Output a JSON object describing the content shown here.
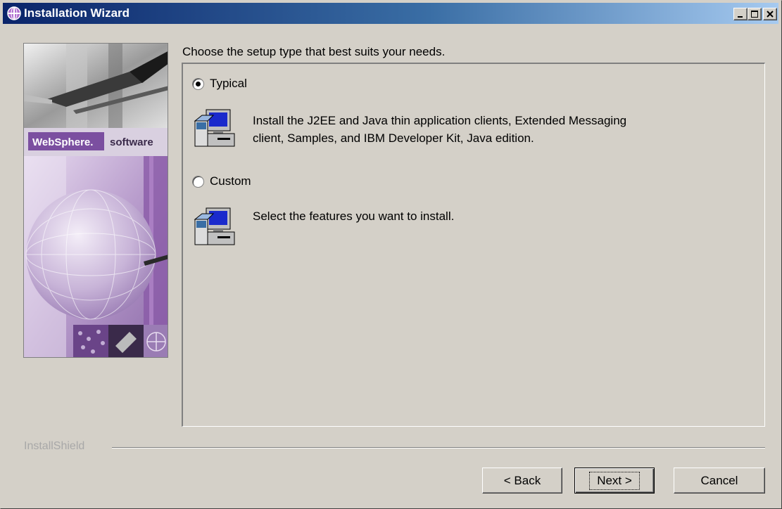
{
  "window": {
    "title": "Installation Wizard",
    "title_icon": "globe-icon",
    "controls": [
      "minimize-icon",
      "maximize-icon",
      "close-icon"
    ]
  },
  "banner": {
    "brand_name": "WebSphere.",
    "brand_suffix": "software",
    "brand_color": "#7b4fa0"
  },
  "main": {
    "prompt": "Choose the setup type that best suits your needs.",
    "options": [
      {
        "label": "Typical",
        "selected": true,
        "icon": "computer-install-icon",
        "description_line1": "Install the J2EE and Java thin application clients, Extended Messaging",
        "description_line2": "client, Samples, and IBM Developer Kit, Java edition."
      },
      {
        "label": "Custom",
        "selected": false,
        "icon": "computer-install-icon",
        "description_line1": "Select the features you want to install.",
        "description_line2": ""
      }
    ]
  },
  "footer": {
    "brand": "InstallShield",
    "back_label": "< Back",
    "next_label": "Next >",
    "cancel_label": "Cancel"
  },
  "colors": {
    "dialog_bg": "#d4d0c8",
    "titlebar_start": "#0a246a",
    "titlebar_end": "#a6caf0"
  }
}
